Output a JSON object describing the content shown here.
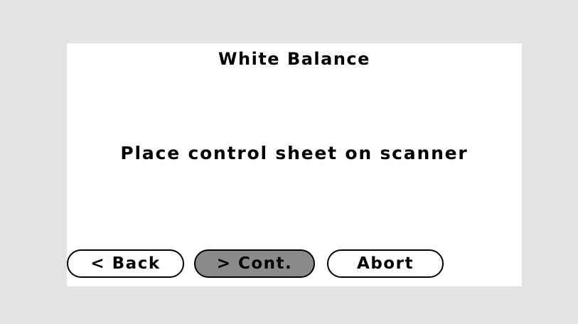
{
  "screen": {
    "title": "White Balance",
    "message": "Place control sheet on scanner"
  },
  "buttons": {
    "back_label": "< Back",
    "cont_label": "> Cont.",
    "abort_label": "Abort"
  },
  "colors": {
    "background": "#e3e3e3",
    "panel": "#ffffff",
    "selected_button": "#8a8a8a"
  }
}
